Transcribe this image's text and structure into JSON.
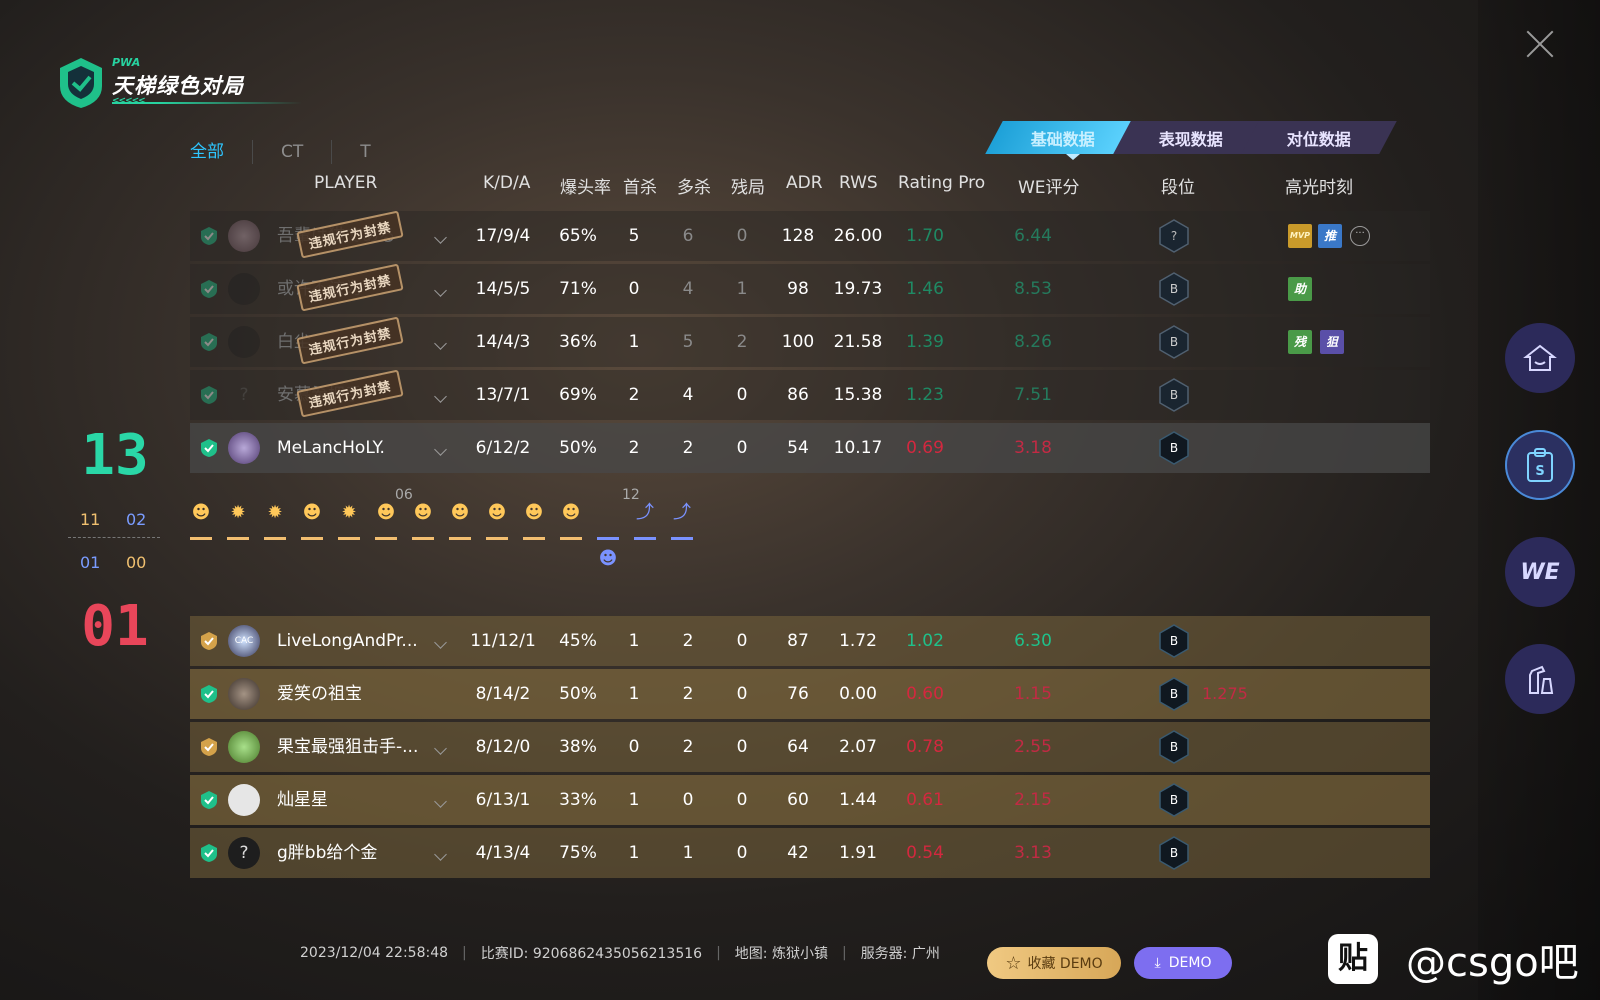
{
  "logo": {
    "small_text": "PWA",
    "title": "天梯绿色对局",
    "arrows": "<<<<<"
  },
  "filters": [
    "全部",
    "CT",
    "T"
  ],
  "data_tabs": [
    "基础数据",
    "表现数据",
    "对位数据"
  ],
  "headers": {
    "player": "PLAYER",
    "kda": "K/D/A",
    "hs": "爆头率",
    "fk": "首杀",
    "multi": "多杀",
    "clutch": "残局",
    "adr": "ADR",
    "rws": "RWS",
    "rating": "Rating Pro",
    "we": "WE评分",
    "rank": "段位",
    "highlights": "高光时刻"
  },
  "ban_stamp": "违规行为封禁",
  "team_a": [
    {
      "name": "吾輩は猫である",
      "avatar": "",
      "kda": "17/9/4",
      "hs": "65%",
      "fk": "5",
      "multi": "6",
      "clutch": "0",
      "adr": "128",
      "rws": "26.00",
      "rating": "1.70",
      "we": "6.44",
      "rank": "?"
    },
    {
      "name": "或许不该为",
      "avatar": "",
      "kda": "14/5/5",
      "hs": "71%",
      "fk": "0",
      "multi": "4",
      "clutch": "1",
      "adr": "98",
      "rws": "19.73",
      "rating": "1.46",
      "we": "8.53",
      "rank": "B"
    },
    {
      "name": "白尘",
      "avatar": "",
      "kda": "14/4/3",
      "hs": "36%",
      "fk": "1",
      "multi": "5",
      "clutch": "2",
      "adr": "100",
      "rws": "21.58",
      "rating": "1.39",
      "we": "8.26",
      "rank": "B"
    },
    {
      "name": "安慕希把手",
      "avatar": "?",
      "kda": "13/7/1",
      "hs": "69%",
      "fk": "2",
      "multi": "4",
      "clutch": "0",
      "adr": "86",
      "rws": "15.38",
      "rating": "1.23",
      "we": "7.51",
      "rank": "B"
    },
    {
      "name": "MeLancHoLY.",
      "avatar": "",
      "kda": "6/12/2",
      "hs": "50%",
      "fk": "2",
      "multi": "2",
      "clutch": "0",
      "adr": "54",
      "rws": "10.17",
      "rating": "0.69",
      "we": "3.18",
      "rank": "B"
    }
  ],
  "team_b": [
    {
      "name": "LiveLongAndPr...",
      "avatar": "CAC",
      "kda": "11/12/1",
      "hs": "45%",
      "fk": "1",
      "multi": "2",
      "clutch": "0",
      "adr": "87",
      "rws": "1.72",
      "rating": "1.02",
      "we": "6.30",
      "rank": "B"
    },
    {
      "name": "爱笑の祖宝",
      "avatar": "",
      "kda": "8/14/2",
      "hs": "50%",
      "fk": "1",
      "multi": "2",
      "clutch": "0",
      "adr": "76",
      "rws": "0.00",
      "rating": "0.60",
      "we": "1.15",
      "rank": "B",
      "extra": "1.275"
    },
    {
      "name": "果宝最强狙击手-...",
      "avatar": "",
      "kda": "8/12/0",
      "hs": "38%",
      "fk": "0",
      "multi": "2",
      "clutch": "0",
      "adr": "64",
      "rws": "2.07",
      "rating": "0.78",
      "we": "2.55",
      "rank": "B"
    },
    {
      "name": "灿星星",
      "avatar": "",
      "kda": "6/13/1",
      "hs": "33%",
      "fk": "1",
      "multi": "0",
      "clutch": "0",
      "adr": "60",
      "rws": "1.44",
      "rating": "0.61",
      "we": "2.15",
      "rank": "B"
    },
    {
      "name": "g胖bb给个金",
      "avatar": "?",
      "kda": "4/13/4",
      "hs": "75%",
      "fk": "1",
      "multi": "1",
      "clutch": "0",
      "adr": "42",
      "rws": "1.91",
      "rating": "0.54",
      "we": "3.13",
      "rank": "B"
    }
  ],
  "score": {
    "team_a": "13",
    "team_b": "01",
    "a_half1": "11",
    "a_half2": "02",
    "b_half1": "01",
    "b_half2": "00"
  },
  "round_markers": {
    "first": "06",
    "second": "12"
  },
  "footer": {
    "datetime": "2023/12/04 22:58:48",
    "match_id": "比赛ID: 9206862435056213516",
    "map": "地图: 炼狱小镇",
    "server": "服务器: 广州",
    "fav_button": "收藏 DEMO",
    "demo_button": "DEMO"
  },
  "watermark": {
    "logo": "贴",
    "text": "@csgo吧"
  },
  "colors": {
    "accent_green": "#2ad7a7",
    "accent_red": "#e8465a",
    "tab_blue": "#2ec6ff",
    "nav_purple": "#2c2a5a"
  }
}
